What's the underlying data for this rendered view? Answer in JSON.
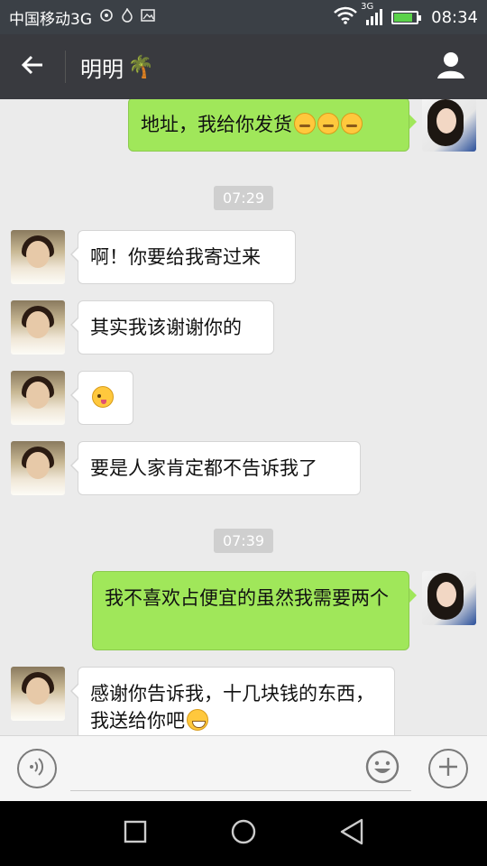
{
  "status_bar": {
    "carrier": "中国移动3G",
    "network": "3G",
    "time": "08:34",
    "battery_level": 0.85,
    "icons": [
      "settings-icon",
      "fire-icon",
      "image-icon",
      "wifi-icon",
      "signal-icon",
      "battery-icon"
    ]
  },
  "header": {
    "contact_name": "明明",
    "contact_emoji": "🌴",
    "back_icon": "back-arrow-icon",
    "profile_icon": "user-icon"
  },
  "messages": [
    {
      "side": "right",
      "text": "地址，我给你发货",
      "emojis": [
        "thinking-emoji",
        "thinking-emoji",
        "thinking-emoji"
      ]
    },
    {
      "type": "time",
      "text": "07:29"
    },
    {
      "side": "left",
      "text": "啊！你要给我寄过来"
    },
    {
      "side": "left",
      "text": "其实我该谢谢你的"
    },
    {
      "side": "left",
      "text": "",
      "emojis": [
        "wink-emoji"
      ]
    },
    {
      "side": "left",
      "text": "要是人家肯定都不告诉我了"
    },
    {
      "type": "time",
      "text": "07:39"
    },
    {
      "side": "right",
      "text": "我不喜欢占便宜的虽然我需要两个"
    },
    {
      "side": "left",
      "text": "感谢你告诉我，十几块钱的东西，我送给你吧",
      "emojis": [
        "grin-emoji"
      ]
    }
  ],
  "input_bar": {
    "voice_icon": "voice-icon",
    "emoji_icon": "emoji-face-icon",
    "plus_icon": "plus-icon",
    "placeholder": ""
  },
  "nav_bar": {
    "icons": [
      "recent-apps-icon",
      "home-icon",
      "back-triangle-icon"
    ]
  },
  "colors": {
    "status_bar": "#3b4046",
    "header": "#393a3f",
    "chat_bg": "#ebebeb",
    "bubble_right": "#a0e75a",
    "bubble_left": "#ffffff"
  }
}
